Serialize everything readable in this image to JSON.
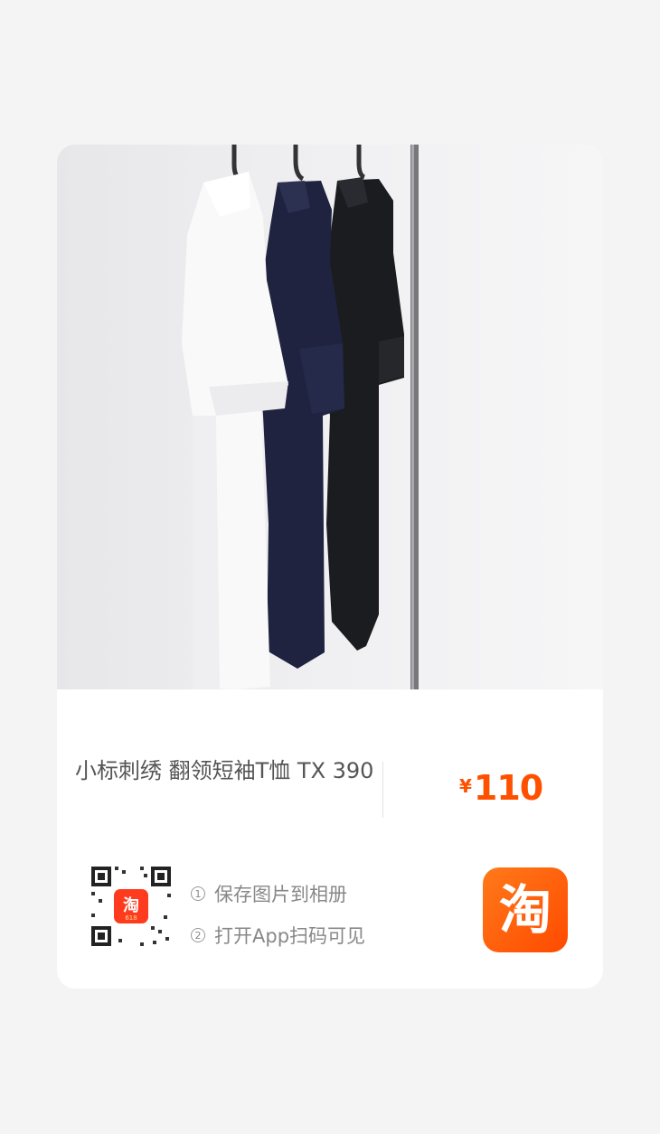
{
  "product": {
    "title": "小标刺绣 翻领短袖T恤 TX 390",
    "currency": "¥",
    "price": "110"
  },
  "share": {
    "step1_num": "1",
    "step1": "保存图片到相册",
    "step2_num": "2",
    "step2": "打开App扫码可见",
    "qr_app_icon_char": "淘",
    "qr_app_icon_sub": "618"
  },
  "brand": {
    "logo_char": "淘",
    "accent_color": "#ff5000"
  }
}
